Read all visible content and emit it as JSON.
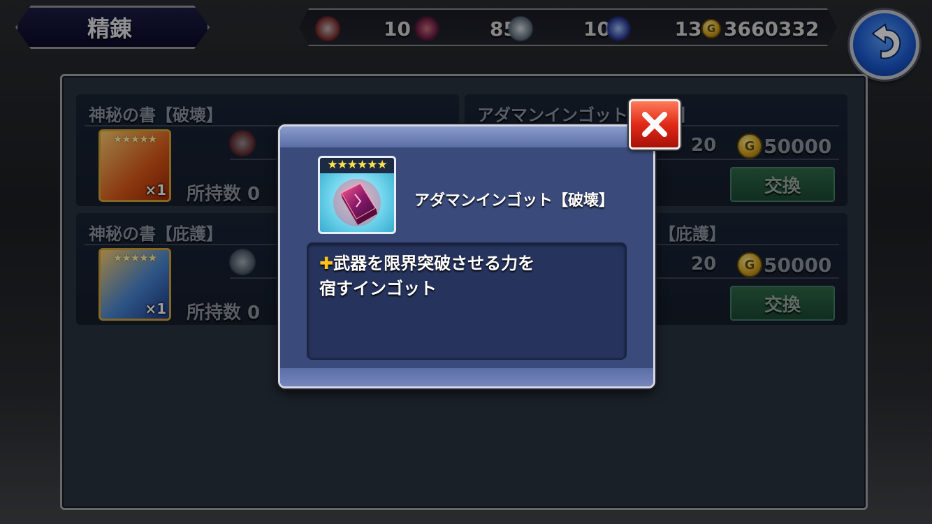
{
  "header": {
    "title": "精錬",
    "currencies": [
      {
        "icon": "red-tome-icon",
        "value": "10"
      },
      {
        "icon": "red-gem-icon",
        "value": "85"
      },
      {
        "icon": "silver-tome-icon",
        "value": "10"
      },
      {
        "icon": "blue-gem-icon",
        "value": "130"
      }
    ],
    "gil": "3660332",
    "gil_symbol": "G"
  },
  "cards": [
    {
      "title": "神秘の書【破壊】",
      "qty": "×1",
      "owned": "所持数 0",
      "stars": "★★★★★"
    },
    {
      "title": "アダマンインゴット【破壊】",
      "count": "20",
      "price": "50000",
      "button": "交換"
    },
    {
      "title": "神秘の書【庇護】",
      "qty": "×1",
      "owned": "所持数 0",
      "stars": "★★★★★"
    },
    {
      "title": "【庇護】",
      "count": "20",
      "price": "50000",
      "button": "交換"
    }
  ],
  "modal": {
    "stars": "★★★★★★",
    "item_name": "アダマンインゴット【破壊】",
    "desc_plus": "✚",
    "desc_line1": "武器を限界突破させる力を",
    "desc_line2": "宿すインゴット"
  },
  "colors": {
    "accent_gold": "#d6a83a",
    "close_red": "#e02a18",
    "back_blue": "#1d5fd8",
    "exchange_green": "#2f6a4a"
  }
}
